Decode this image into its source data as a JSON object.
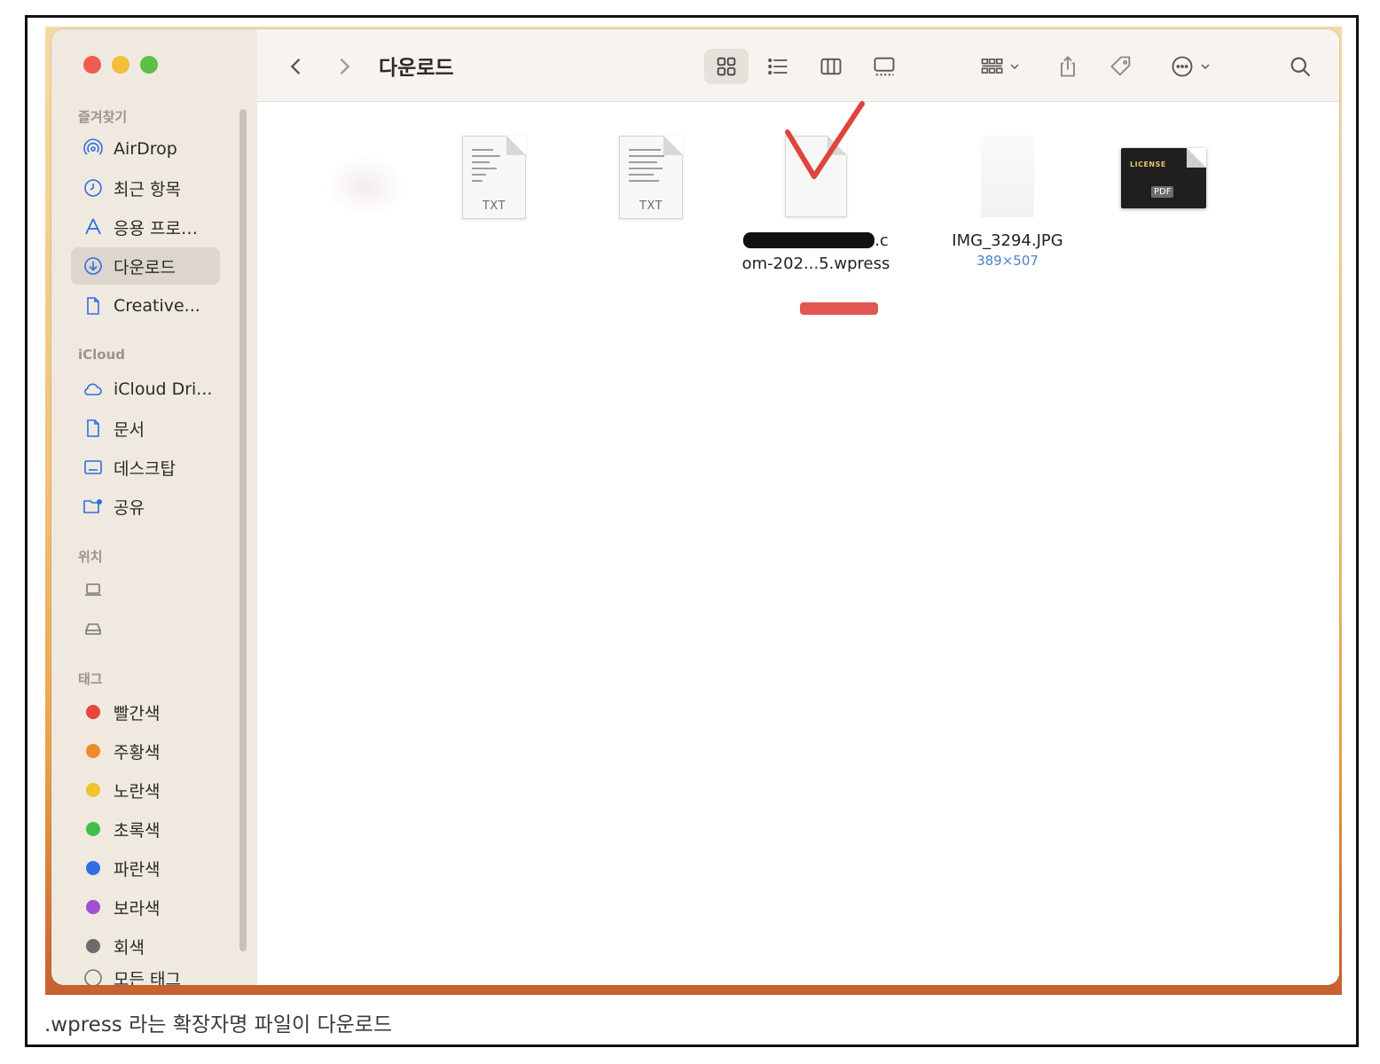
{
  "window": {
    "title": "다운로드"
  },
  "sidebar": {
    "favorites_header": "즐겨찾기",
    "favorites": [
      {
        "label": "AirDrop",
        "icon": "airdrop-icon"
      },
      {
        "label": "최근 항목",
        "icon": "clock-icon"
      },
      {
        "label": "응용 프로…",
        "icon": "applications-icon"
      },
      {
        "label": "다운로드",
        "icon": "download-icon",
        "active": true
      },
      {
        "label": "Creative...",
        "icon": "document-icon"
      }
    ],
    "icloud_header": "iCloud",
    "icloud": [
      {
        "label": "iCloud Dri...",
        "icon": "cloud-icon"
      },
      {
        "label": "문서",
        "icon": "document-icon"
      },
      {
        "label": "데스크탑",
        "icon": "desktop-icon"
      },
      {
        "label": "공유",
        "icon": "shared-folder-icon"
      }
    ],
    "locations_header": "위치",
    "tags_header": "태그",
    "tags": [
      {
        "label": "빨간색",
        "color": "#e8453c"
      },
      {
        "label": "주황색",
        "color": "#f08a2e"
      },
      {
        "label": "노란색",
        "color": "#f2c230"
      },
      {
        "label": "초록색",
        "color": "#3fbf48"
      },
      {
        "label": "파란색",
        "color": "#2f6fe0"
      },
      {
        "label": "보라색",
        "color": "#a24fd1"
      },
      {
        "label": "회색",
        "color": "#8e8e93"
      }
    ],
    "all_tags_label": "모든 태그"
  },
  "files": [
    {
      "ext": "TXT"
    },
    {
      "ext": "TXT"
    },
    {
      "name_tail": ".c",
      "name_line2": "om-202...5.wpress"
    },
    {
      "name": "IMG_3294.JPG",
      "meta": "389×507"
    },
    {
      "pdf_label": "LICENSE",
      "pdf_badge": "PDF"
    }
  ],
  "caption": ".wpress 라는 확장자명 파일이 다운로드"
}
